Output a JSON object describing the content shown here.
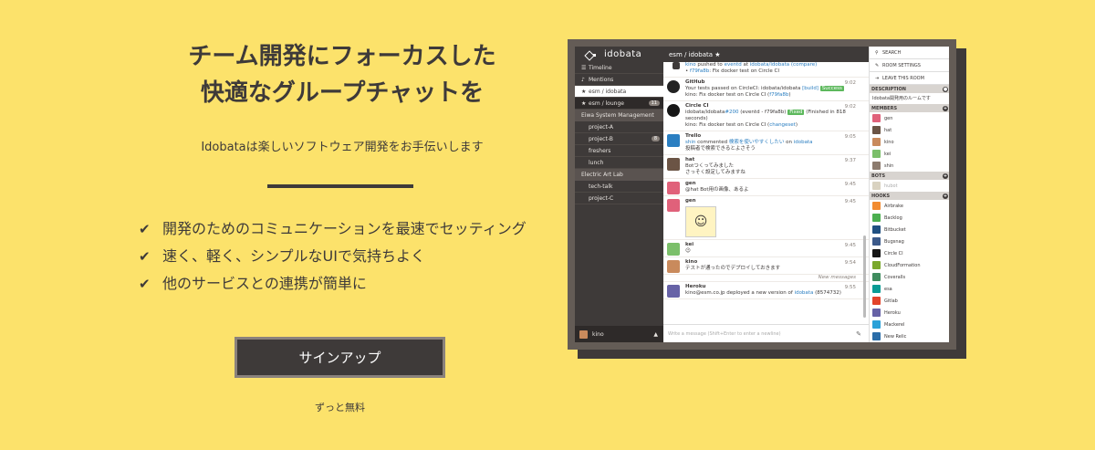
{
  "hero": {
    "title_line1": "チーム開発にフォーカスした",
    "title_line2": "快適なグループチャットを",
    "subtitle": "Idobataは楽しいソフトウェア開発をお手伝いします",
    "features": [
      "開発のためのコミュニケーションを最速でセッティング",
      "速く、軽く、シンプルなUIで気持ちよく",
      "他のサービスとの連携が簡単に"
    ],
    "signup_label": "サインアップ",
    "free_note": "ずっと無料"
  },
  "app": {
    "logo": "idobata",
    "sidebar": {
      "timeline": "Timeline",
      "mentions": "Mentions",
      "active_room": "esm / idobata",
      "lounge": "esm / lounge",
      "lounge_badge": "11",
      "orgs": [
        {
          "name": "Eiwa System Management",
          "rooms": [
            {
              "name": "project-A",
              "badge": ""
            },
            {
              "name": "project-B",
              "badge": "8"
            },
            {
              "name": "freshers",
              "badge": ""
            },
            {
              "name": "lunch",
              "badge": ""
            }
          ]
        },
        {
          "name": "Electric Art Lab",
          "rooms": [
            {
              "name": "tech-talk",
              "badge": ""
            },
            {
              "name": "project-C",
              "badge": ""
            }
          ]
        }
      ],
      "user": "kino"
    },
    "room_title": "esm / idobata ★",
    "messages": {
      "m0_a": "kino",
      "m0_b": " pushed to ",
      "m0_c": "eventd",
      "m0_d": " at ",
      "m0_e": "idobata/idobata",
      "m0_f": "(compare)",
      "m0_g": "f79fa8b",
      "m0_h": ": Fix docker test on Circle CI",
      "github_who": "GitHub",
      "github_time": "9:02",
      "github_l1a": "Your tests passed on CircleCI: idobata/idobata ",
      "github_l1b": "[build]",
      "github_l1c": "Success",
      "github_l2a": "kino: Fix docker test on Circle CI (",
      "github_l2b": "f79fa8b",
      "github_l2c": ")",
      "circle_who": "Circle CI",
      "circle_time": "9:02",
      "circle_l1a": "idobata/idobata",
      "circle_l1b": "#200",
      "circle_l1c": " (eventd - f79fa8b) ",
      "circle_l1d": "Fixed",
      "circle_l1e": " (Finished in 818 seconds)",
      "circle_l2a": "kino: Fix docker test on Circle CI (",
      "circle_l2b": "changeset",
      "circle_l2c": ")",
      "trello_who": "Trello",
      "trello_time": "9:05",
      "trello_l1a": "shin",
      "trello_l1b": " commented ",
      "trello_l1c": "検索を使いやすくしたい",
      "trello_l1d": " on ",
      "trello_l1e": "idobata",
      "trello_l2": "投稿者で検索できるとよさそう",
      "hat_who": "hat",
      "hat_time": "9:37",
      "hat_l1": "Botつくってみました",
      "hat_l2": "さっそく設定してみますね",
      "gen1_who": "gen",
      "gen1_time": "9:45",
      "gen1_l1": "@hat Bot用の画像、あるよ",
      "gen2_who": "gen",
      "gen2_time": "9:45",
      "kei_who": "kei",
      "kei_time": "9:45",
      "kei_l1": "😉",
      "kino_who": "kino",
      "kino_time": "9:54",
      "kino_l1": "テストが通ったのでデプロイしておきます",
      "new_messages": "New messages",
      "heroku_who": "Heroku",
      "heroku_time": "9:55",
      "heroku_l1a": "kino@esm.co.jp deployed a new version of ",
      "heroku_l1b": "idobata",
      "heroku_l1c": " (8574732)"
    },
    "composer_placeholder": "Write a message (Shift+Enter to enter a newline)",
    "right": {
      "search": "SEARCH",
      "room_settings": "ROOM SETTINGS",
      "leave": "LEAVE THIS ROOM",
      "description_label": "DESCRIPTION",
      "description": "Idobata開発用のルームです",
      "members_label": "MEMBERS",
      "members": [
        "gen",
        "hat",
        "kino",
        "kei",
        "shin"
      ],
      "bots_label": "BOTS",
      "bots": [
        "hubot"
      ],
      "hooks_label": "HOOKS",
      "hooks": [
        "Airbrake",
        "Backlog",
        "Bitbucket",
        "Bugsnag",
        "Circle CI",
        "CloudFormation",
        "Coveralls",
        "esa",
        "Gitlab",
        "Heroku",
        "Mackerel",
        "New Relic"
      ]
    }
  }
}
